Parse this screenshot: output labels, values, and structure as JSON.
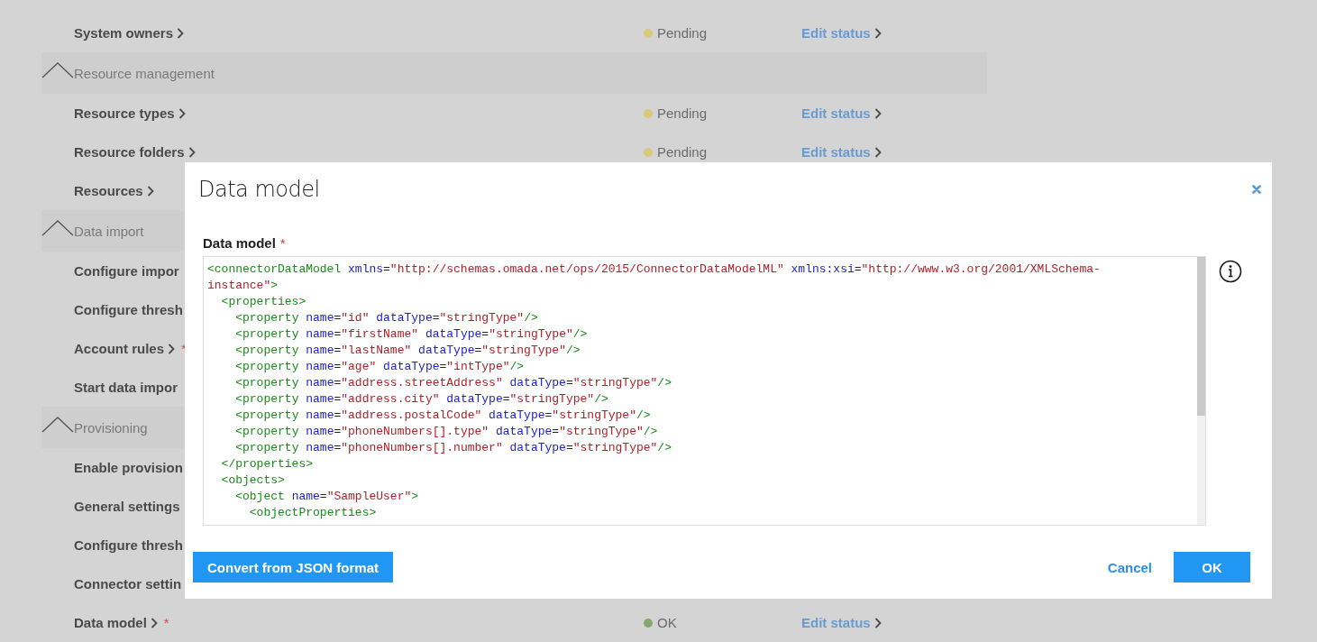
{
  "checklist": [
    {
      "kind": "item",
      "label": "System owners",
      "chevron": true,
      "status": {
        "text": "Pending",
        "color": "#d8c97c"
      },
      "action": "Edit status"
    },
    {
      "kind": "section",
      "label": "Resource management",
      "expanded": true
    },
    {
      "kind": "item",
      "label": "Resource types",
      "chevron": true,
      "status": {
        "text": "Pending",
        "color": "#d8c97c"
      },
      "action": "Edit status"
    },
    {
      "kind": "item",
      "label": "Resource folders",
      "chevron": true,
      "status": {
        "text": "Pending",
        "color": "#d8c97c"
      },
      "action": "Edit status"
    },
    {
      "kind": "item",
      "label": "Resources",
      "chevron": true
    },
    {
      "kind": "section",
      "label": "Data import",
      "expanded": true
    },
    {
      "kind": "item",
      "label": "Configure impor",
      "chevron": false
    },
    {
      "kind": "item",
      "label": "Configure thresh",
      "chevron": false
    },
    {
      "kind": "item",
      "label": "Account rules",
      "chevron": true,
      "mark": "*"
    },
    {
      "kind": "item",
      "label": "Start data impor",
      "chevron": false
    },
    {
      "kind": "section",
      "label": "Provisioning",
      "expanded": true
    },
    {
      "kind": "item",
      "label": "Enable provision",
      "chevron": false
    },
    {
      "kind": "item",
      "label": "General settings",
      "chevron": false
    },
    {
      "kind": "item",
      "label": "Configure thresh",
      "chevron": false
    },
    {
      "kind": "item",
      "label": "Connector settin",
      "chevron": false
    },
    {
      "kind": "item",
      "label": "Data model",
      "chevron": true,
      "mark": "*",
      "status": {
        "text": "OK",
        "color": "#86a86e"
      },
      "action": "Edit status"
    }
  ],
  "dialog": {
    "title": "Data model",
    "field_label": "Data model",
    "required_mark": "*",
    "code_lines": [
      [
        {
          "kind": "tag",
          "text": "<connectorDataModel"
        },
        {
          "kind": "attr",
          "text": " xmlns"
        },
        {
          "kind": "eq",
          "text": "="
        },
        {
          "kind": "value",
          "text": "\"http://schemas.omada.net/ops/2015/ConnectorDataModelML\""
        },
        {
          "kind": "attr",
          "text": " xmlns:xsi"
        },
        {
          "kind": "eq",
          "text": "="
        },
        {
          "kind": "value",
          "text": "\"http://www.w3.org/2001/XMLSchema-instance\""
        },
        {
          "kind": "tag",
          "text": ">"
        }
      ],
      [
        {
          "kind": "tag",
          "text": "  <properties>"
        }
      ],
      [
        {
          "kind": "tag",
          "text": "    <property"
        },
        {
          "kind": "attr",
          "text": " name"
        },
        {
          "kind": "eq",
          "text": "="
        },
        {
          "kind": "value",
          "text": "\"id\""
        },
        {
          "kind": "attr",
          "text": " dataType"
        },
        {
          "kind": "eq",
          "text": "="
        },
        {
          "kind": "value",
          "text": "\"stringType\""
        },
        {
          "kind": "tag",
          "text": "/>"
        }
      ],
      [
        {
          "kind": "tag",
          "text": "    <property"
        },
        {
          "kind": "attr",
          "text": " name"
        },
        {
          "kind": "eq",
          "text": "="
        },
        {
          "kind": "value",
          "text": "\"firstName\""
        },
        {
          "kind": "attr",
          "text": " dataType"
        },
        {
          "kind": "eq",
          "text": "="
        },
        {
          "kind": "value",
          "text": "\"stringType\""
        },
        {
          "kind": "tag",
          "text": "/>"
        }
      ],
      [
        {
          "kind": "tag",
          "text": "    <property"
        },
        {
          "kind": "attr",
          "text": " name"
        },
        {
          "kind": "eq",
          "text": "="
        },
        {
          "kind": "value",
          "text": "\"lastName\""
        },
        {
          "kind": "attr",
          "text": " dataType"
        },
        {
          "kind": "eq",
          "text": "="
        },
        {
          "kind": "value",
          "text": "\"stringType\""
        },
        {
          "kind": "tag",
          "text": "/>"
        }
      ],
      [
        {
          "kind": "tag",
          "text": "    <property"
        },
        {
          "kind": "attr",
          "text": " name"
        },
        {
          "kind": "eq",
          "text": "="
        },
        {
          "kind": "value",
          "text": "\"age\""
        },
        {
          "kind": "attr",
          "text": " dataType"
        },
        {
          "kind": "eq",
          "text": "="
        },
        {
          "kind": "value",
          "text": "\"intType\""
        },
        {
          "kind": "tag",
          "text": "/>"
        }
      ],
      [
        {
          "kind": "tag",
          "text": "    <property"
        },
        {
          "kind": "attr",
          "text": " name"
        },
        {
          "kind": "eq",
          "text": "="
        },
        {
          "kind": "value",
          "text": "\"address.streetAddress\""
        },
        {
          "kind": "attr",
          "text": " dataType"
        },
        {
          "kind": "eq",
          "text": "="
        },
        {
          "kind": "value",
          "text": "\"stringType\""
        },
        {
          "kind": "tag",
          "text": "/>"
        }
      ],
      [
        {
          "kind": "tag",
          "text": "    <property"
        },
        {
          "kind": "attr",
          "text": " name"
        },
        {
          "kind": "eq",
          "text": "="
        },
        {
          "kind": "value",
          "text": "\"address.city\""
        },
        {
          "kind": "attr",
          "text": " dataType"
        },
        {
          "kind": "eq",
          "text": "="
        },
        {
          "kind": "value",
          "text": "\"stringType\""
        },
        {
          "kind": "tag",
          "text": "/>"
        }
      ],
      [
        {
          "kind": "tag",
          "text": "    <property"
        },
        {
          "kind": "attr",
          "text": " name"
        },
        {
          "kind": "eq",
          "text": "="
        },
        {
          "kind": "value",
          "text": "\"address.postalCode\""
        },
        {
          "kind": "attr",
          "text": " dataType"
        },
        {
          "kind": "eq",
          "text": "="
        },
        {
          "kind": "value",
          "text": "\"stringType\""
        },
        {
          "kind": "tag",
          "text": "/>"
        }
      ],
      [
        {
          "kind": "tag",
          "text": "    <property"
        },
        {
          "kind": "attr",
          "text": " name"
        },
        {
          "kind": "eq",
          "text": "="
        },
        {
          "kind": "value",
          "text": "\"phoneNumbers[].type\""
        },
        {
          "kind": "attr",
          "text": " dataType"
        },
        {
          "kind": "eq",
          "text": "="
        },
        {
          "kind": "value",
          "text": "\"stringType\""
        },
        {
          "kind": "tag",
          "text": "/>"
        }
      ],
      [
        {
          "kind": "tag",
          "text": "    <property"
        },
        {
          "kind": "attr",
          "text": " name"
        },
        {
          "kind": "eq",
          "text": "="
        },
        {
          "kind": "value",
          "text": "\"phoneNumbers[].number\""
        },
        {
          "kind": "attr",
          "text": " dataType"
        },
        {
          "kind": "eq",
          "text": "="
        },
        {
          "kind": "value",
          "text": "\"stringType\""
        },
        {
          "kind": "tag",
          "text": "/>"
        }
      ],
      [
        {
          "kind": "tag",
          "text": "  </properties>"
        }
      ],
      [
        {
          "kind": "tag",
          "text": "  <objects>"
        }
      ],
      [
        {
          "kind": "tag",
          "text": "    <object"
        },
        {
          "kind": "attr",
          "text": " name"
        },
        {
          "kind": "eq",
          "text": "="
        },
        {
          "kind": "value",
          "text": "\"SampleUser\""
        },
        {
          "kind": "tag",
          "text": ">"
        }
      ],
      [
        {
          "kind": "tag",
          "text": "      <objectProperties>"
        }
      ]
    ],
    "footer_left": [
      {
        "kind": "primary",
        "label": "Convert from JSON format"
      }
    ],
    "footer_right": [
      {
        "kind": "link",
        "label": "Cancel"
      },
      {
        "kind": "primary",
        "label": "OK"
      }
    ]
  }
}
